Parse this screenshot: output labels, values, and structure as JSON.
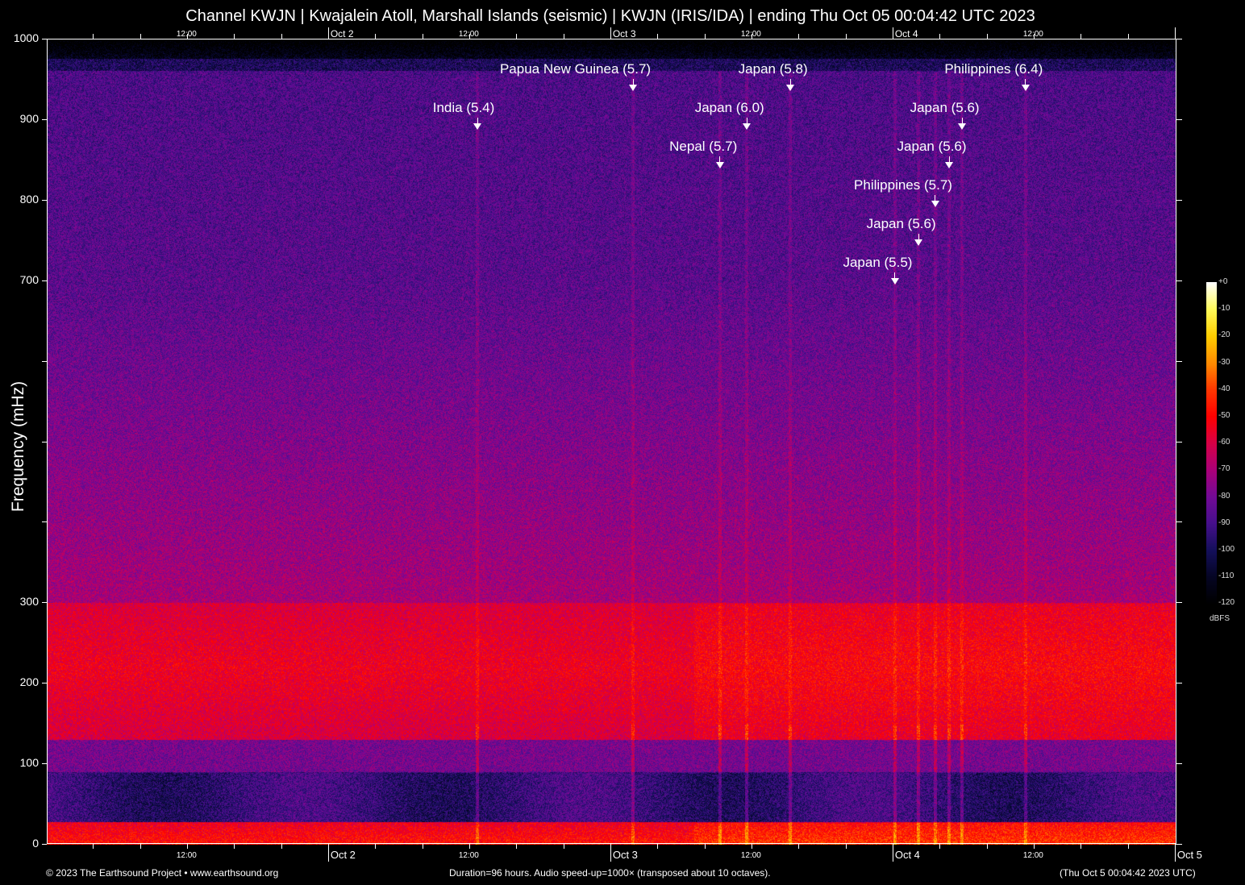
{
  "title": "Channel KWJN | Kwajalein Atoll, Marshall Islands (seismic) | KWJN (IRIS/IDA) | ending Thu Oct 05 00:04:42 UTC 2023",
  "footer": {
    "left": "© 2023 The Earthsound Project • www.earthsound.org",
    "center": "Duration=96 hours. Audio speed-up=1000× (transposed about 10 octaves).",
    "right": "(Thu Oct  5 00:04:42 2023 UTC)"
  },
  "chart_data": {
    "type": "heatmap",
    "title": "Channel KWJN | Kwajalein Atoll, Marshall Islands (seismic) | KWJN (IRIS/IDA) | ending Thu Oct 05 00:04:42 UTC 2023",
    "ylabel": "Frequency (mHz)",
    "ylim": [
      0,
      1000
    ],
    "y_ticks": [
      0,
      100,
      200,
      300,
      400,
      500,
      600,
      700,
      800,
      900,
      1000
    ],
    "y_tick_labels": [
      "0",
      "100",
      "200",
      "300",
      "",
      "",
      "",
      "700",
      "800",
      "900",
      "1000"
    ],
    "x_range_hours": [
      0,
      96
    ],
    "x_ticks": [
      {
        "hours": 11.92,
        "label": "12:00",
        "major": false
      },
      {
        "hours": 23.92,
        "label": "Oct  2",
        "major": true
      },
      {
        "hours": 35.92,
        "label": "12:00",
        "major": false
      },
      {
        "hours": 47.92,
        "label": "Oct  3",
        "major": true
      },
      {
        "hours": 59.92,
        "label": "12:00",
        "major": false
      },
      {
        "hours": 71.92,
        "label": "Oct  4",
        "major": true
      },
      {
        "hours": 83.92,
        "label": "12:00",
        "major": false
      },
      {
        "hours": 95.92,
        "label": "Oct  5",
        "major": true
      }
    ],
    "colorbar": {
      "label": "dBFS",
      "range": [
        -120,
        0
      ],
      "ticks": [
        "+0",
        "-10",
        "-20",
        "-30",
        "-40",
        "-50",
        "-60",
        "-70",
        "-80",
        "-90",
        "-100",
        "-110",
        "-120"
      ]
    },
    "events": [
      {
        "label": "Papua New Guinea (5.7)",
        "hours": 49.85,
        "label_level": 0
      },
      {
        "label": "Japan (5.8)",
        "hours": 63.2,
        "label_level": 0
      },
      {
        "label": "Philippines (6.4)",
        "hours": 83.2,
        "label_level": 0
      },
      {
        "label": "India (5.4)",
        "hours": 36.6,
        "label_level": 1
      },
      {
        "label": "Japan (6.0)",
        "hours": 59.5,
        "label_level": 1
      },
      {
        "label": "Japan (5.6)",
        "hours": 77.8,
        "label_level": 1
      },
      {
        "label": "Nepal (5.7)",
        "hours": 57.2,
        "label_level": 2
      },
      {
        "label": "Japan (5.6)",
        "hours": 76.7,
        "label_level": 2
      },
      {
        "label": "Philippines (5.7)",
        "hours": 75.5,
        "label_level": 3
      },
      {
        "label": "Japan (5.6)",
        "hours": 74.1,
        "label_level": 4
      },
      {
        "label": "Japan (5.5)",
        "hours": 72.1,
        "label_level": 5
      }
    ]
  }
}
